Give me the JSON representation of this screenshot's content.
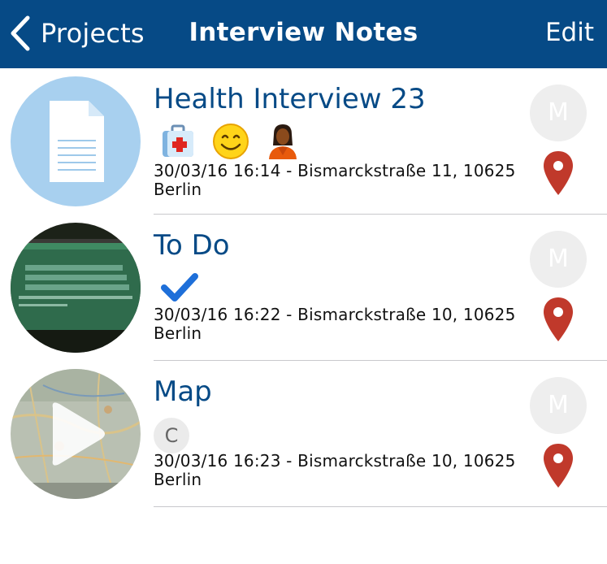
{
  "nav": {
    "back_label": "Projects",
    "title": "Interview Notes",
    "edit_label": "Edit"
  },
  "notes": [
    {
      "title": "Health Interview 23",
      "tags": [
        "medical-kit-icon",
        "smiley-face-icon",
        "person-icon"
      ],
      "datetime_location": "30/03/16 16:14 - Bismarckstraße 11, 10625 Berlin",
      "avatar_letter": "M",
      "thumbnail": "document-icon"
    },
    {
      "title": "To Do",
      "tags": [
        "checkmark-icon"
      ],
      "datetime_location": "30/03/16 16:22 - Bismarckstraße 10, 10625 Berlin",
      "avatar_letter": "M",
      "thumbnail": "photo-screen"
    },
    {
      "title": "Map",
      "tag_letter": "C",
      "datetime_location": "30/03/16 16:23 - Bismarckstraße 10, 10625 Berlin",
      "avatar_letter": "M",
      "thumbnail": "video-map-play-icon"
    }
  ],
  "colors": {
    "navbar": "#064a86",
    "title_text": "#064a86",
    "pin": "#c0392b",
    "check": "#1e6fd9",
    "doc_thumb_bg": "#a8d0ef"
  }
}
